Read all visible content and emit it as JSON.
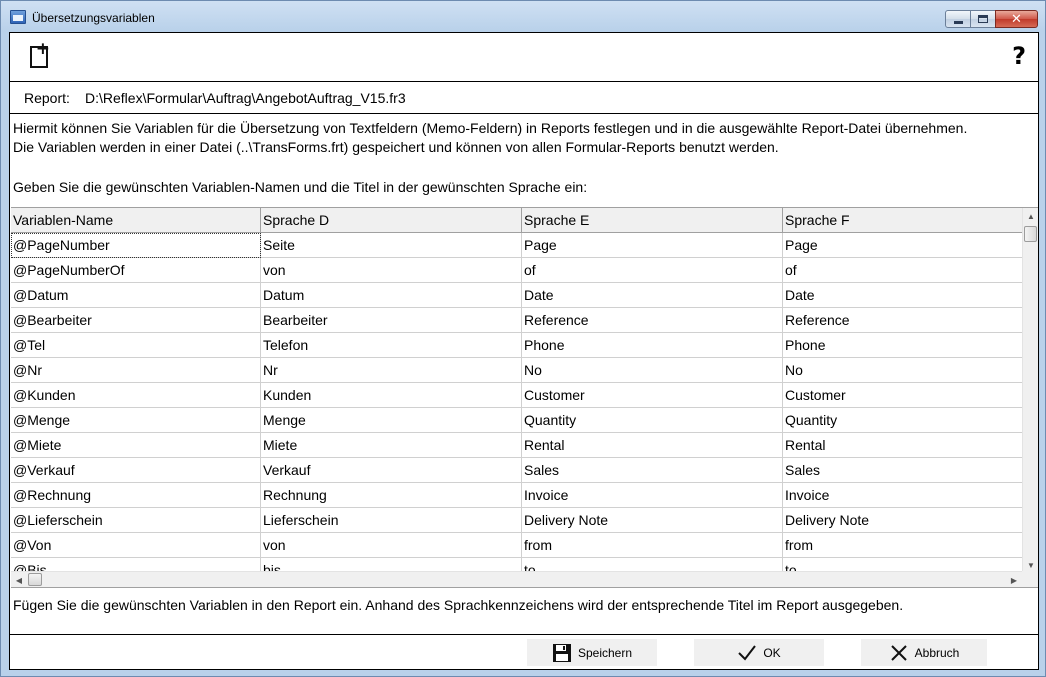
{
  "window": {
    "title": "Übersetzungsvariablen"
  },
  "toolbar": {
    "new_icon": "new-document-icon",
    "help_label": "?"
  },
  "report": {
    "label": "Report:",
    "path": "D:\\Reflex\\Formular\\Auftrag\\AngebotAuftrag_V15.fr3"
  },
  "description": {
    "line1": "Hiermit können Sie Variablen für die Übersetzung von Textfeldern (Memo-Feldern) in Reports festlegen und in die ausgewählte Report-Datei übernehmen.",
    "line2": "Die Variablen werden in einer Datei (..\\TransForms.frt) gespeichert und können von allen Formular-Reports benutzt werden.",
    "line3": "Geben Sie die gewünschten Variablen-Namen und die Titel in der gewünschten Sprache ein:"
  },
  "grid": {
    "columns": [
      "Variablen-Name",
      "Sprache D",
      "Sprache E",
      "Sprache F"
    ],
    "rows": [
      [
        "@PageNumber",
        "Seite",
        "Page",
        "Page"
      ],
      [
        "@PageNumberOf",
        "von",
        "of",
        "of"
      ],
      [
        "@Datum",
        "Datum",
        "Date",
        "Date"
      ],
      [
        "@Bearbeiter",
        "Bearbeiter",
        "Reference",
        "Reference"
      ],
      [
        "@Tel",
        "Telefon",
        "Phone",
        "Phone"
      ],
      [
        "@Nr",
        "Nr",
        "No",
        "No"
      ],
      [
        "@Kunden",
        "Kunden",
        "Customer",
        "Customer"
      ],
      [
        "@Menge",
        "Menge",
        "Quantity",
        "Quantity"
      ],
      [
        "@Miete",
        "Miete",
        "Rental",
        "Rental"
      ],
      [
        "@Verkauf",
        "Verkauf",
        "Sales",
        "Sales"
      ],
      [
        "@Rechnung",
        "Rechnung",
        "Invoice",
        "Invoice"
      ],
      [
        "@Lieferschein",
        "Lieferschein",
        "Delivery Note",
        "Delivery Note"
      ],
      [
        "@Von",
        "von",
        "from",
        "from"
      ],
      [
        "@Bis",
        "bis",
        "to",
        "to"
      ]
    ]
  },
  "footer": {
    "hint": "Fügen Sie die gewünschten Variablen in den Report ein. Anhand des Sprachkennzeichens wird der entsprechende Titel im Report ausgegeben."
  },
  "buttons": {
    "save": "Speichern",
    "ok": "OK",
    "cancel": "Abbruch"
  }
}
